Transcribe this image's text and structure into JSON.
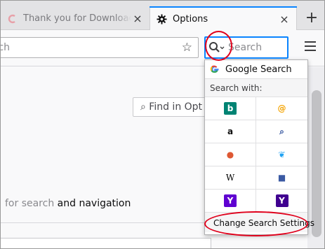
{
  "tabs": [
    {
      "title": "Thank you for Downloading",
      "favicon": "comodo-c-icon",
      "close": "×"
    },
    {
      "title": "Options",
      "favicon": "gear-icon",
      "close": "×"
    }
  ],
  "new_tab_label": "+",
  "navbar": {
    "url_text": "rch",
    "search_placeholder": "Search"
  },
  "content": {
    "find_placeholder": "⌕ Find in Opt",
    "desc_faded": "for search",
    "desc_rest": " and navigation"
  },
  "popup": {
    "current_engine": "Google Search",
    "search_with": "Search with:",
    "engines": [
      {
        "name": "bing-icon",
        "glyph": "b",
        "color": "#008373"
      },
      {
        "name": "yandex-icon",
        "glyph": "@",
        "color": "#f4a300"
      },
      {
        "name": "amazon-icon",
        "glyph": "a",
        "color": "#111111"
      },
      {
        "name": "magnifier-search-icon",
        "glyph": "⌕",
        "color": "#2b4e9b"
      },
      {
        "name": "duckduckgo-icon",
        "glyph": "●",
        "color": "#de5833"
      },
      {
        "name": "twitter-icon",
        "glyph": "❦",
        "color": "#1da1f2"
      },
      {
        "name": "wikipedia-icon",
        "glyph": "W",
        "color": "#000000"
      },
      {
        "name": "ebay-shopping-bag-icon",
        "glyph": "■",
        "color": "#3b5aa3"
      },
      {
        "name": "yahoo-icon",
        "glyph": "Y",
        "color": "#5f01d1"
      },
      {
        "name": "yahoo-alt-icon",
        "glyph": "Y",
        "color": "#400090"
      }
    ],
    "change_settings": "Change Search Settings"
  },
  "colors": {
    "accent": "#0a84ff",
    "annotation_red": "#e0001b"
  }
}
